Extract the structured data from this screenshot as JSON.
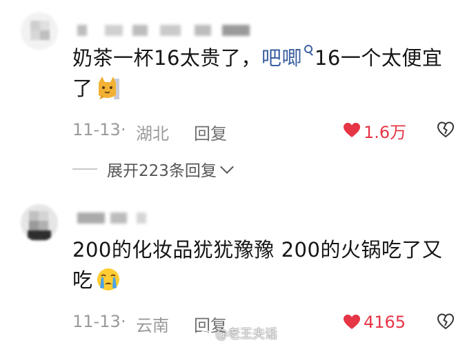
{
  "comments": [
    {
      "text_before": "奶茶一杯16太贵了，",
      "mention": "吧唧",
      "text_after": "16一个太便宜了",
      "emoji": "cat-emoji",
      "date": "11-13",
      "separator": "·",
      "location": "湖北",
      "reply_label": "回复",
      "likes": "1.6万",
      "expand_label": "展开223条回复"
    },
    {
      "text": "200的化妆品犹犹豫豫 200的火锅吃了又吃",
      "emoji": "crying-emoji",
      "date": "11-13",
      "separator": "·",
      "location": "云南",
      "reply_label": "回复",
      "likes": "4165"
    }
  ],
  "watermark": "@老王夫话",
  "colors": {
    "like": "#e63545",
    "mention": "#3b5fa0",
    "meta": "#9a9a9a"
  },
  "icons": [
    "search-icon",
    "heart-icon",
    "dislike-icon",
    "chevron-down-icon",
    "weibo-icon"
  ]
}
